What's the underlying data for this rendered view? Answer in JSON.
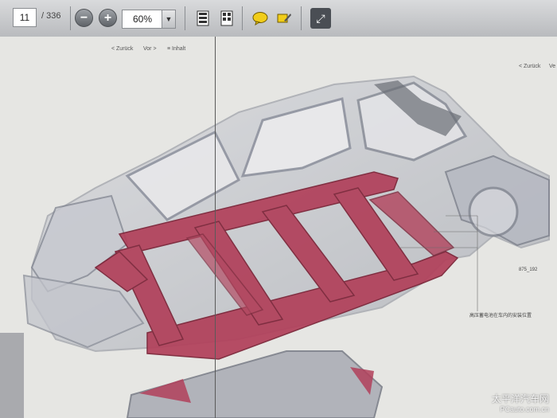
{
  "toolbar": {
    "page_number": "11",
    "page_total": "/ 336",
    "zoom_level": "60%",
    "icons": [
      "zoom-out-icon",
      "zoom-in-icon",
      "single-page-icon",
      "scroll-pages-icon",
      "comment-icon",
      "highlight-icon",
      "expand-icon"
    ]
  },
  "document": {
    "nav_left": {
      "back": "< Zurück",
      "forward": "Vor >",
      "contents": "≡ Inhalt"
    },
    "nav_right": {
      "back": "< Zurück",
      "forward_partial": "Ve"
    },
    "figure_code": "875_192",
    "callout_label": "高压蓄电池在车内的安装位置",
    "colors": {
      "frame_highlight": "#b1405a",
      "body_gray": "#b7bac3"
    }
  },
  "watermark": {
    "cn": "太平洋汽车网",
    "url": "PCauto.com.cn"
  }
}
